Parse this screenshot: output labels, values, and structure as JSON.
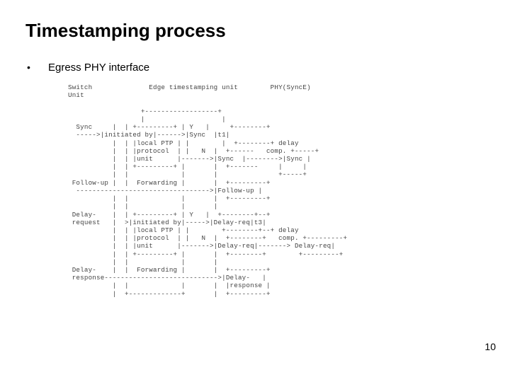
{
  "slide": {
    "title": "Timestamping process",
    "bullet": "•",
    "subtitle": "Egress PHY interface",
    "page_number": "10",
    "diagram": "Switch              Edge timestamping unit        PHY(SyncE)\nUnit\n\n                  +------------------+\n                  |                   |\n  Sync     |  | +---------+ | Y   |     +--------+\n  ----->|initiated by|------>|Sync  |t1|\n           |  | |local PTP | |        |  +--------+ delay\n           |  | |protocol  | |   N  |  +------   comp. +-----+\n           |  | |unit      |------->|Sync  |-------->|Sync |\n           |  | +---------+ |       |  +-------     |     |\n           |  |             |       |               +-----+\n Follow-up |  |  Forwarding |       |  +---------+\n  --------------------------------->|Follow-up |\n           |  |             |       |  +---------+\n           |  |             |       |\n Delay-    |  | +---------+ | Y   |  +--------+--+\n request   |  >|initiated by|----->|Delay-req|t3|\n           |  | |local PTP | |        +--------+--+ delay\n           |  | |protocol  | |   N  |  +--------+   comp. +---------+\n           |  | |unit      |------->|Delay-req|-------> Delay-req|\n           |  | +---------+ |       |  +--------+        +---------+\n           |  |             |       |\n Delay-    |  |  Forwarding |       |  +---------+\n response---------------------------->|Delay-   |\n           |  |             |       |  |response |\n           |  +-------------+       |  +---------+"
  }
}
